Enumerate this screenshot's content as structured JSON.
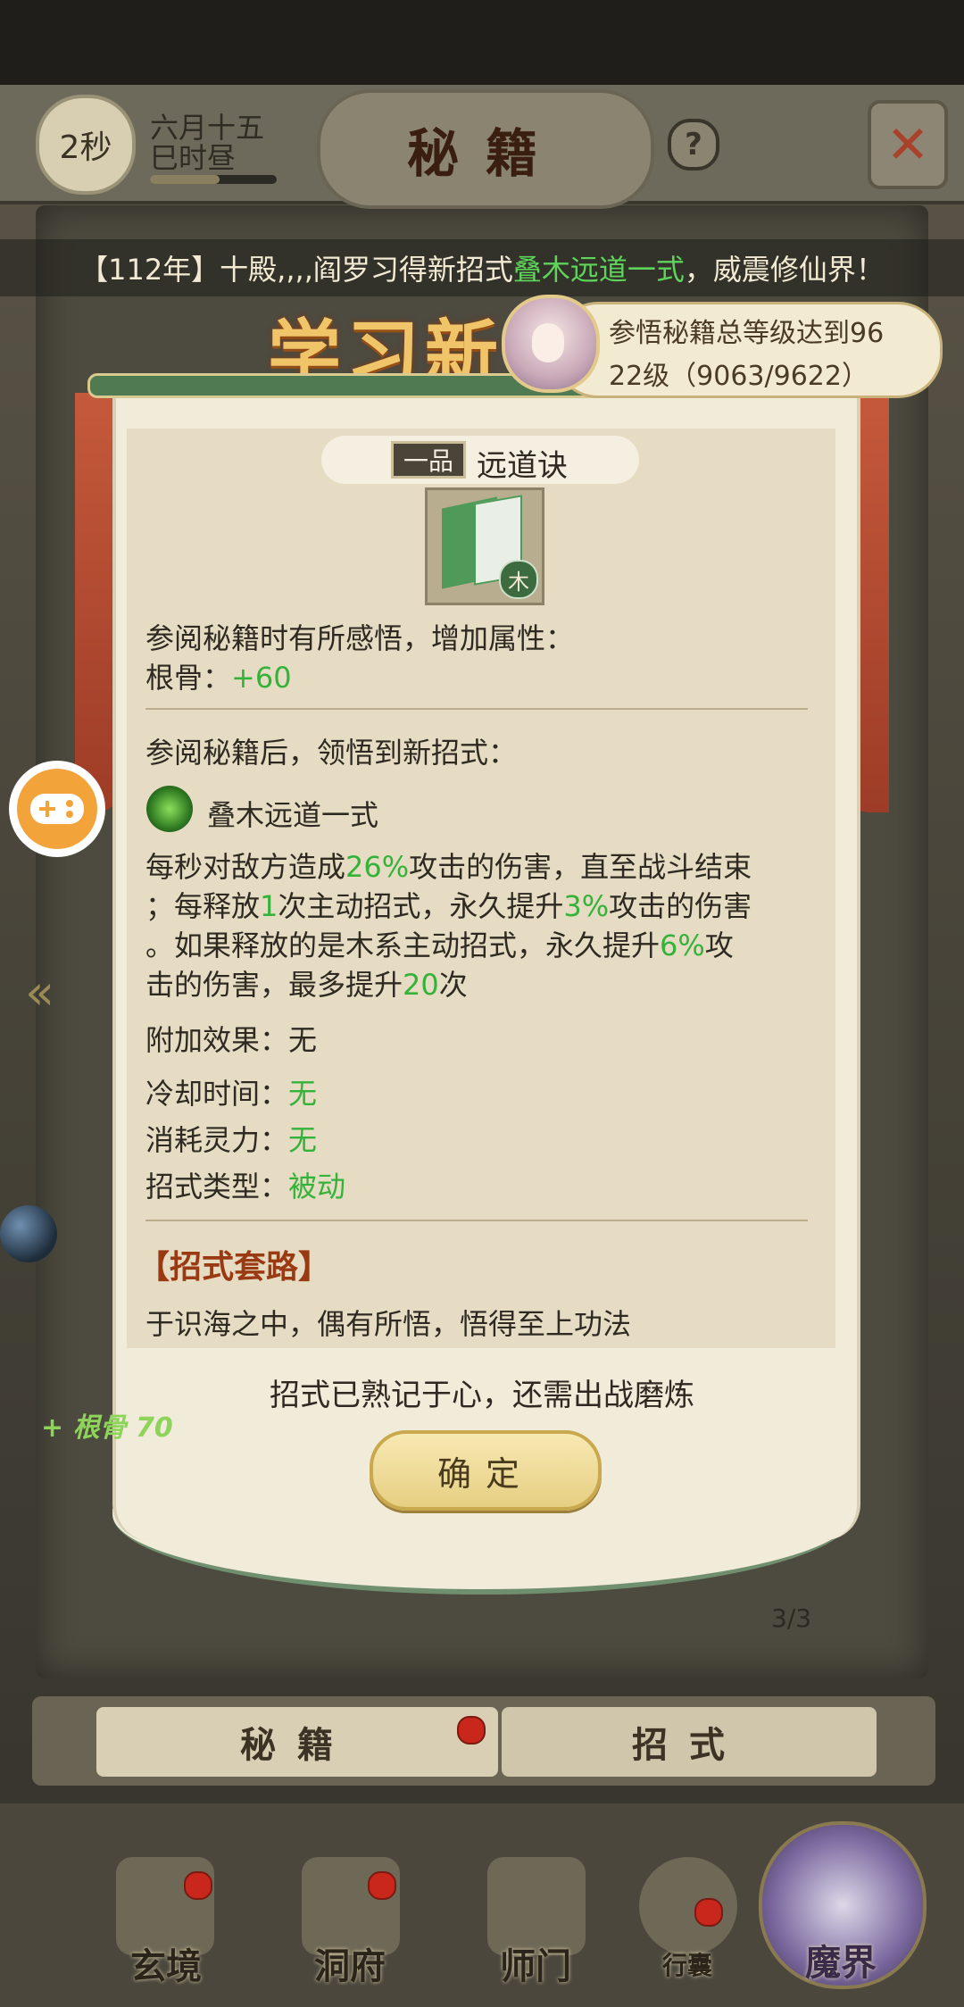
{
  "header": {
    "timer": "2秒",
    "date_line1": "六月十五",
    "date_line2": "巳时昼",
    "date_progress": 0.55,
    "title": "秘籍",
    "help_glyph": "?",
    "close_glyph": "✕"
  },
  "ticker": {
    "prefix": "【112年】十殿,,,,阎罗习得新招式",
    "highlight": "叠木远道一式",
    "suffix": "，威震修仙界！"
  },
  "banner": {
    "title": "学习新",
    "requirement_line1": "参悟秘籍总等级达到96",
    "requirement_line2": "22级（9063/9622）"
  },
  "book": {
    "grade": "一品",
    "name": "远道诀",
    "element": "木",
    "insight_intro": "参阅秘籍时有所感悟，增加属性：",
    "attr_label": "根骨：",
    "attr_value": "+60",
    "learn_intro": "参阅秘籍后，领悟到新招式：",
    "skill_name": "叠木远道一式",
    "desc": {
      "l1a": "每秒对敌方造成",
      "l1b": "26%",
      "l1c": "攻击的伤害，直至战斗结束",
      "l2a": "；每释放",
      "l2b": "1",
      "l2c": "次主动招式，永久提升",
      "l2d": "3%",
      "l2e": "攻击的伤害",
      "l3a": "。如果释放的是木系主动招式，永久提升",
      "l3b": "6%",
      "l3c": "攻",
      "l4a": "击的伤害，最多提升",
      "l4b": "20",
      "l4c": "次"
    },
    "extra_label": "附加效果：",
    "extra_value": "无",
    "cooldown_label": "冷却时间：",
    "cooldown_value": "无",
    "cost_label": "消耗灵力：",
    "cost_value": "无",
    "type_label": "招式类型：",
    "type_value": "被动",
    "routine_title": "【招式套路】",
    "routine_text": "于识海之中，偶有所悟，悟得至上功法",
    "learned_text": "招式已熟记于心，还需出战磨炼",
    "confirm_label": "确定",
    "page_counter": "3/3"
  },
  "side": {
    "gain_text": "+ 根骨 70"
  },
  "tabs": {
    "secret": "秘籍",
    "moves": "招式"
  },
  "nav": {
    "items": [
      "玄境",
      "洞府",
      "师门",
      "行囊",
      "魔界"
    ]
  },
  "colors": {
    "highlight_green": "#35b23a",
    "ticker_green": "#5fd45a",
    "accent_red": "#9a3a12"
  }
}
